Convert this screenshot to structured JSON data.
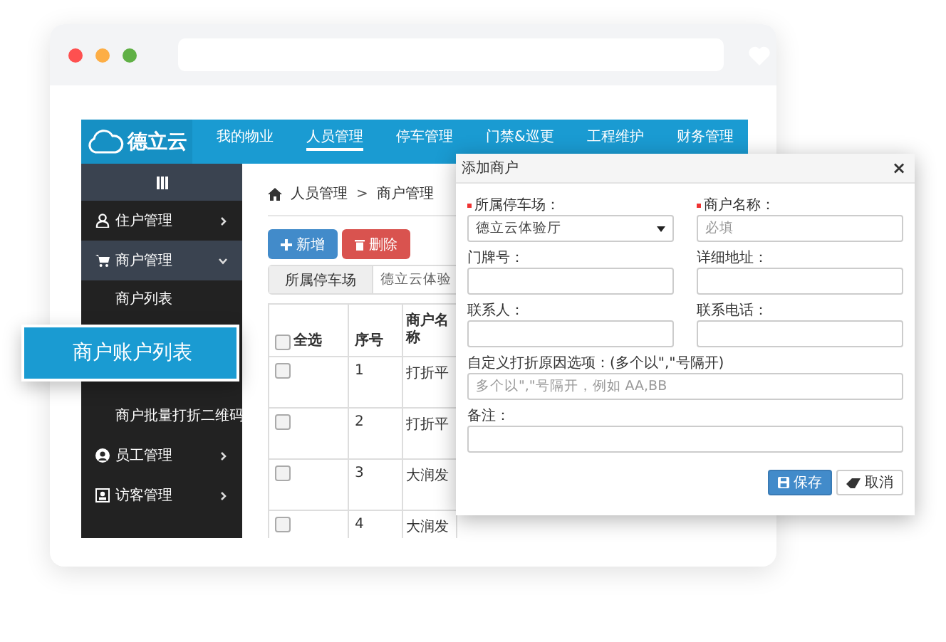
{
  "nav": {
    "logo": "德立云",
    "items": [
      {
        "label": "我的物业",
        "selected": false
      },
      {
        "label": "人员管理",
        "selected": true
      },
      {
        "label": "停车管理",
        "selected": false
      },
      {
        "label": "门禁&巡更",
        "selected": false
      },
      {
        "label": "工程维护",
        "selected": false
      },
      {
        "label": "财务管理",
        "selected": false
      }
    ]
  },
  "sidebar": {
    "items": [
      {
        "label": "住户管理",
        "expanded": false
      },
      {
        "label": "商户管理",
        "expanded": true,
        "children": [
          {
            "label": "商户列表"
          },
          {
            "label": "商户批量打折二维码"
          }
        ]
      },
      {
        "label": "员工管理",
        "expanded": false
      },
      {
        "label": "访客管理",
        "expanded": false
      }
    ]
  },
  "breadcrumb": {
    "separator": ">",
    "items": [
      "人员管理",
      "商户管理"
    ]
  },
  "toolbar": [
    {
      "label": "新增",
      "kind": "add"
    },
    {
      "label": "删除",
      "kind": "delete"
    }
  ],
  "filter": {
    "label": "所属停车场",
    "value": "德立云体验"
  },
  "table": {
    "select_all": {
      "label": "全选",
      "checked": false
    },
    "columns": [
      "序号",
      "商户名称"
    ],
    "rows": [
      {
        "checked": false,
        "cells": [
          "1",
          "打折平"
        ]
      },
      {
        "checked": false,
        "cells": [
          "2",
          "打折平"
        ]
      },
      {
        "checked": false,
        "cells": [
          "3",
          "大润发"
        ]
      },
      {
        "checked": false,
        "cells": [
          "4",
          "大润发"
        ]
      }
    ]
  },
  "callout": "商户账户列表",
  "dialog": {
    "title": "添加商户",
    "close": "×",
    "fields": [
      {
        "label": "所属停车场：",
        "required": true,
        "kind": "select",
        "value": "德立云体验厅"
      },
      {
        "label": "商户名称：",
        "required": true,
        "kind": "input",
        "placeholder": "必填"
      },
      {
        "label": "门牌号：",
        "required": false,
        "kind": "input"
      },
      {
        "label": "详细地址：",
        "required": false,
        "kind": "input"
      },
      {
        "label": "联系人：",
        "required": false,
        "kind": "input"
      },
      {
        "label": "联系电话：",
        "required": false,
        "kind": "input"
      },
      {
        "label": "自定义打折原因选项：(多个以\",\"号隔开)",
        "required": false,
        "kind": "wide",
        "placeholder": "多个以\",\"号隔开，例如 AA,BB"
      },
      {
        "label": "备注：",
        "required": false,
        "kind": "wide"
      }
    ],
    "buttons": [
      {
        "label": "保存",
        "kind": "save"
      },
      {
        "label": "取消",
        "kind": "cancel"
      }
    ]
  }
}
